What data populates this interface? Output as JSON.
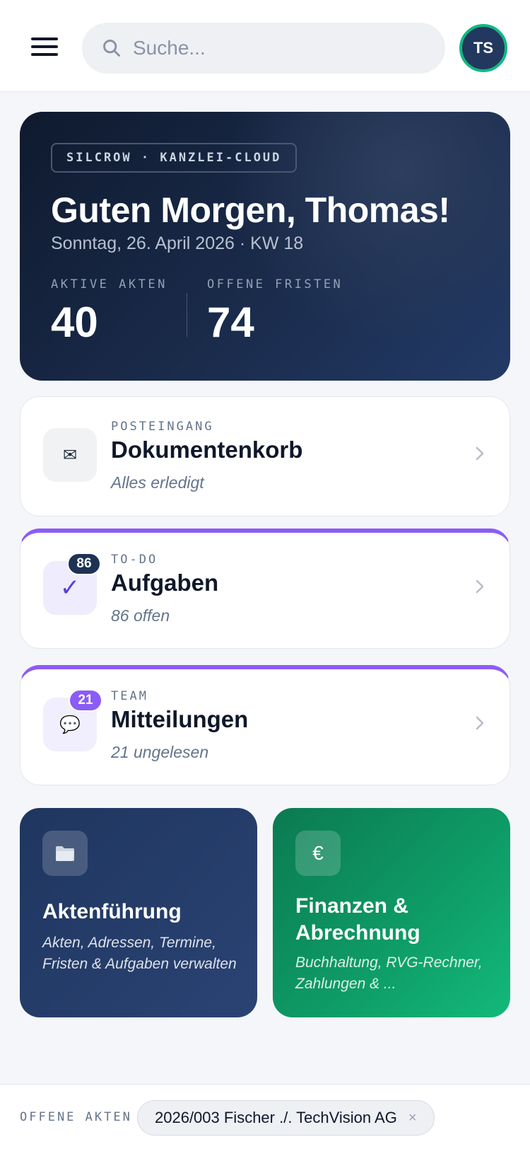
{
  "header": {
    "search_placeholder": "Suche...",
    "avatar_initials": "TS"
  },
  "hero": {
    "tag": "SILCROW · KANZLEI-CLOUD",
    "greeting": "Guten Morgen, Thomas!",
    "date": "Sonntag, 26. April 2026 · KW 18",
    "stats": [
      {
        "label": "AKTIVE AKTEN",
        "value": "40"
      },
      {
        "label": "OFFENE FRISTEN",
        "value": "74"
      }
    ]
  },
  "cards": [
    {
      "kicker": "POSTEINGANG",
      "title": "Dokumentenkorb",
      "subtitle": "Alles erledigt",
      "icon": "envelope-icon",
      "glyph": "✉"
    },
    {
      "kicker": "TO-DO",
      "title": "Aufgaben",
      "subtitle": "86 offen",
      "badge": "86",
      "icon": "checkmark-icon",
      "glyph": "✓",
      "accent": "#8b5cf6"
    },
    {
      "kicker": "TEAM",
      "title": "Mitteilungen",
      "subtitle": "21 ungelesen",
      "badge": "21",
      "icon": "speech-bubble-icon",
      "glyph": "💬",
      "accent": "#8b5cf6"
    }
  ],
  "tiles": [
    {
      "title": "Aktenführung",
      "description": "Akten, Adressen, Termine, Fristen & Aufgaben verwalten",
      "icon": "folder-icon"
    },
    {
      "title": "Finanzen & Abrechnung",
      "description": "Buchhaltung, RVG-Rechner, Zahlungen & ...",
      "icon": "euro-icon",
      "glyph": "€"
    }
  ],
  "bottom": {
    "label": "OFFENE AKTEN",
    "chip": "2026/003 Fischer ./. TechVision AG",
    "chip_close": "×"
  },
  "colors": {
    "hero_dark": "#0f1a2e",
    "accent_purple": "#8b5cf6",
    "green": "#10b981",
    "navy": "#23385e"
  }
}
